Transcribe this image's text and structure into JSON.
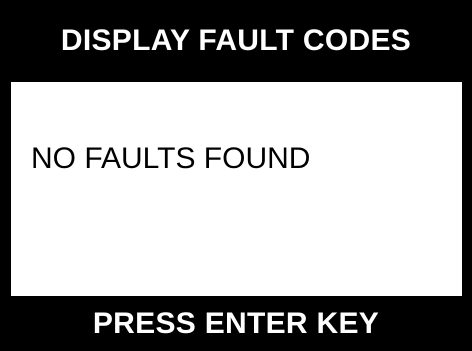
{
  "header": {
    "title": "DISPLAY FAULT CODES"
  },
  "main": {
    "message": "NO FAULTS FOUND"
  },
  "footer": {
    "prompt": "PRESS ENTER KEY"
  },
  "colors": {
    "background": "#ffffff",
    "bar": "#000000",
    "bar_text": "#ffffff",
    "body_text": "#000000"
  }
}
